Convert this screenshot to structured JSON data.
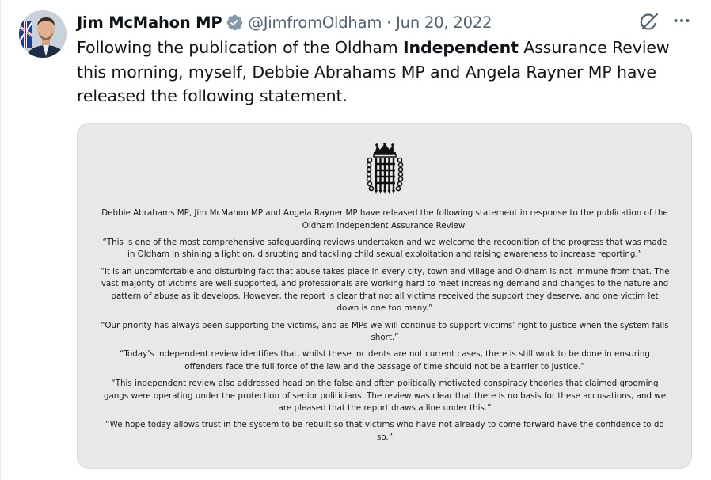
{
  "tweet": {
    "author_name": "Jim McMahon MP",
    "handle": "@JimfromOldham",
    "separator": "·",
    "date": "Jun 20, 2022",
    "text_before": "Following the publication of the Oldham ",
    "text_bold": "Independent",
    "text_after": " Assurance Review this morning, myself, Debbie Abrahams MP and Angela Rayner MP have released the following statement."
  },
  "statement": {
    "paragraphs": [
      "Debbie Abrahams MP, Jim McMahon MP and Angela Rayner MP have released the following statement in response to the publication of the Oldham Independent Assurance Review:",
      "“This is one of the most comprehensive safeguarding reviews undertaken and we welcome the recognition of the progress that was made in Oldham in shining a light on, disrupting and tackling child sexual exploitation and raising awareness to increase reporting.”",
      "“It is an uncomfortable and disturbing fact that abuse takes place in every city, town and village and Oldham is not immune from that. The vast majority of victims are well supported, and professionals are working hard to meet increasing demand and changes to the nature and pattern of abuse as it develops. However, the report is clear that not all victims received the support they deserve, and one victim let down is one too many.”",
      "“Our priority has always been supporting the victims, and as MPs we will continue to support victims’ right to justice when the system falls short.”",
      "“Today’s independent review identifies that, whilst these incidents are not current cases, there is still work to be done in ensuring offenders face the full force of the law and the passage of time should not be a barrier to justice.”",
      "“This independent review also addressed head on the false and often politically motivated conspiracy theories that claimed grooming gangs were operating under the protection of senior politicians. The review was clear that there is no basis for these accusations, and we are pleased that the report draws a line under this.”",
      "“We hope today allows trust in the system to be rebuilt so that victims who have not already to come forward have the confidence to do so.”"
    ]
  },
  "icons": {
    "verified": "verified-badge-icon",
    "grok": "grok-icon",
    "more": "more-icon",
    "emblem": "portcullis-emblem-icon"
  },
  "colors": {
    "verified_badge": "#829aab",
    "muted_text": "#536471",
    "media_background": "#e8e8e8"
  }
}
